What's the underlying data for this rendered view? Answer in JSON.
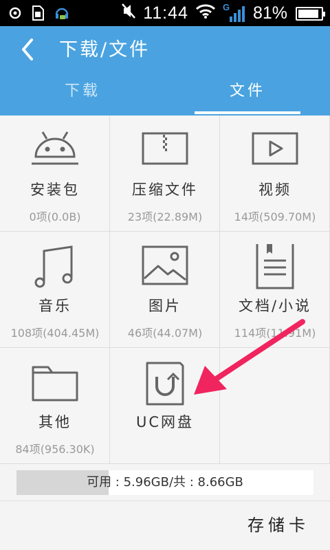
{
  "status_bar": {
    "time": "11:44",
    "battery_percent": "81%",
    "network_label": "G",
    "battery_level": 0.81
  },
  "header": {
    "title": "下载/文件",
    "tabs": [
      {
        "label": "下载",
        "selected": false
      },
      {
        "label": "文件",
        "selected": true
      }
    ]
  },
  "categories": [
    {
      "label": "安装包",
      "count": "0项(0.0B)",
      "icon": "android-icon"
    },
    {
      "label": "压缩文件",
      "count": "23项(22.89M)",
      "icon": "archive-icon"
    },
    {
      "label": "视频",
      "count": "14项(509.70M)",
      "icon": "video-icon"
    },
    {
      "label": "音乐",
      "count": "108项(404.45M)",
      "icon": "music-note-icon"
    },
    {
      "label": "图片",
      "count": "46项(44.07M)",
      "icon": "picture-icon"
    },
    {
      "label": "文档/小说",
      "count": "114项(11.91M)",
      "icon": "document-icon"
    },
    {
      "label": "其他",
      "count": "84项(956.30K)",
      "icon": "folder-icon"
    },
    {
      "label": "UC网盘",
      "count": "",
      "icon": "uc-cloud-icon"
    }
  ],
  "storage": {
    "text": "可用 : 5.96GB/共 : 8.66GB",
    "used_fraction": 0.31
  },
  "footer": {
    "storage_card_label": "存储卡"
  },
  "annotation": {
    "arrow_color": "#f0245e"
  },
  "colors": {
    "header_bg": "#4aa3e0",
    "icon_gray": "#666666"
  }
}
